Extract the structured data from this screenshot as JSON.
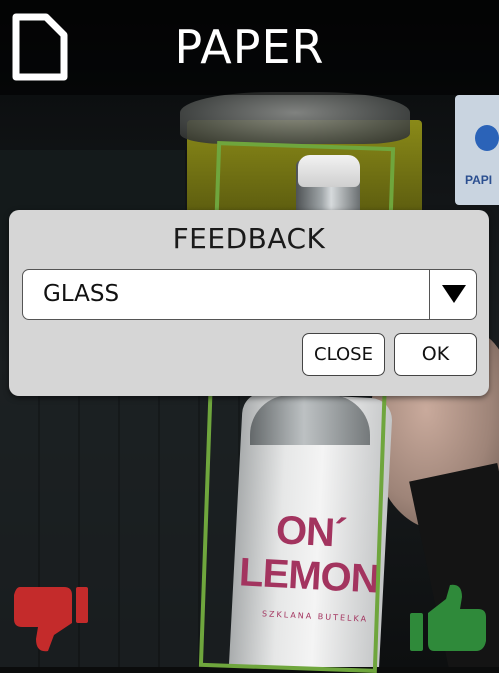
{
  "header": {
    "title": "PAPER",
    "icon": "document-icon"
  },
  "photo": {
    "sign_text": "PAPI",
    "brand_text_line1": "ON´",
    "brand_text_line2": "LEMON",
    "brand_sub": "SZKLANA BUTELKA"
  },
  "detection": {
    "color": "#6fa63d"
  },
  "feedback_dialog": {
    "title": "FEEDBACK",
    "selected_option": "GLASS",
    "dropdown_icon": "triangle-down-icon",
    "close_label": "CLOSE",
    "ok_label": "OK"
  },
  "feedback_buttons": {
    "dislike_icon": "thumbs-down-icon",
    "dislike_color": "#c42b2b",
    "like_icon": "thumbs-up-icon",
    "like_color": "#2f8a3a"
  }
}
